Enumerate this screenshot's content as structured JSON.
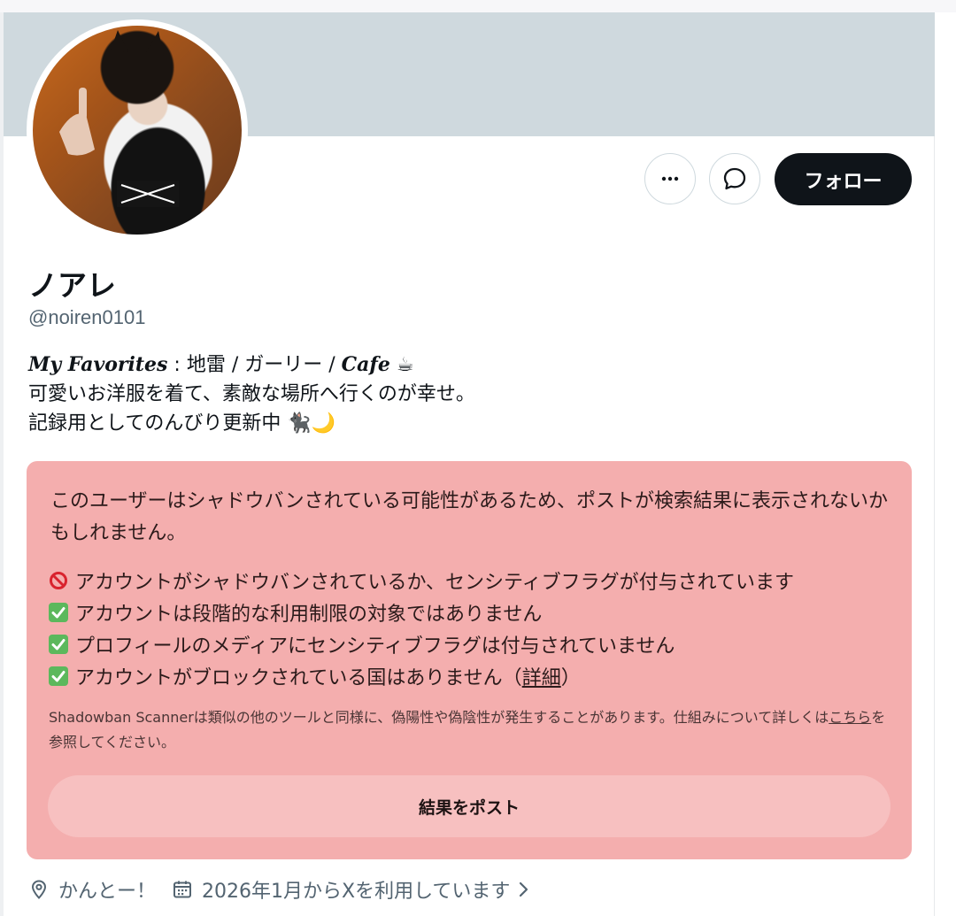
{
  "profile": {
    "display_name": "ノアレ",
    "handle": "@noiren0101",
    "follow_label": "フォロー",
    "bio": {
      "line1_fav": "My Favorites",
      "line1_sep": " : 地雷 / ガーリー / ",
      "line1_cafe": "Cafe",
      "line1_emoji": "☕",
      "line2": "可愛いお洋服を着て、素敵な場所へ行くのが幸せ。",
      "line3": "記録用としてのんびり更新中",
      "line3_emoji": "🐈‍⬛🌙"
    },
    "location": "かんとー！",
    "joined": "2026年1月からXを利用しています"
  },
  "scanner": {
    "intro": "このユーザーはシャドウバンされている可能性があるため、ポストが検索結果に表示されないかもしれません。",
    "checks": [
      {
        "status": "fail",
        "icon": "prohibited-icon",
        "text": "アカウントがシャドウバンされているか、センシティブフラグが付与されています"
      },
      {
        "status": "pass",
        "icon": "check-mark-icon",
        "text": "アカウントは段階的な利用制限の対象ではありません"
      },
      {
        "status": "pass",
        "icon": "check-mark-icon",
        "text": "プロフィールのメディアにセンシティブフラグは付与されていません"
      },
      {
        "status": "pass",
        "icon": "check-mark-icon",
        "text_before": "アカウントがブロックされている国はありません（",
        "link": "詳細",
        "text_after": "）"
      }
    ],
    "disclaimer_before": "Shadowban Scannerは類似の他のツールと同様に、偽陽性や偽陰性が発生することがあります。仕組みについて詳しくは",
    "disclaimer_link": "こちら",
    "disclaimer_after": "を参照してください。",
    "post_button": "結果をポスト"
  },
  "colors": {
    "banner": "#cfd9de",
    "panel": "#f4aeae",
    "follow_bg": "#0f1419",
    "secondary_text": "#536471"
  }
}
